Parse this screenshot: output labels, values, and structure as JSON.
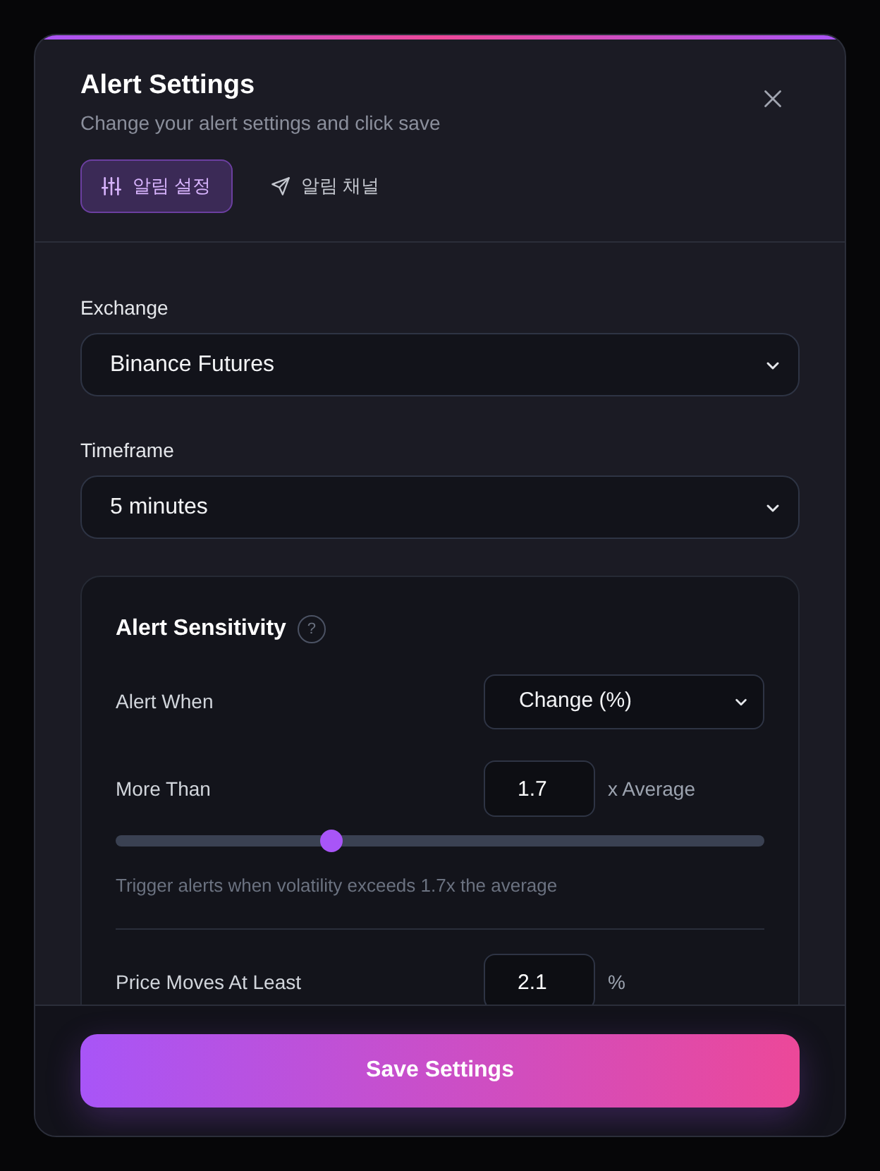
{
  "dialog": {
    "title": "Alert Settings",
    "subtitle": "Change your alert settings and click save"
  },
  "tabs": [
    {
      "label": "알림 설정",
      "selected": true
    },
    {
      "label": "알림 채널",
      "selected": false
    }
  ],
  "fields": [
    {
      "label": "Exchange",
      "value": "Binance Futures"
    },
    {
      "label": "Timeframe",
      "value": "5 minutes"
    }
  ],
  "sensitivity": {
    "title": "Alert Sensitivity",
    "help": "?",
    "sections": [
      {
        "rows": [
          {
            "kind": "select",
            "label": "Alert When",
            "value": "Change (%)"
          },
          {
            "kind": "number",
            "label": "More Than",
            "value": "1.7",
            "unit": "x Average"
          },
          {
            "kind": "slider",
            "level": 0.333
          },
          {
            "kind": "hint",
            "text": "Trigger alerts when volatility exceeds 1.7x the average"
          }
        ]
      },
      {
        "rows": [
          {
            "kind": "number",
            "label": "Price Moves At Least",
            "value": "2.1",
            "unit": "%"
          }
        ]
      }
    ]
  },
  "save_button": "Save Settings"
}
